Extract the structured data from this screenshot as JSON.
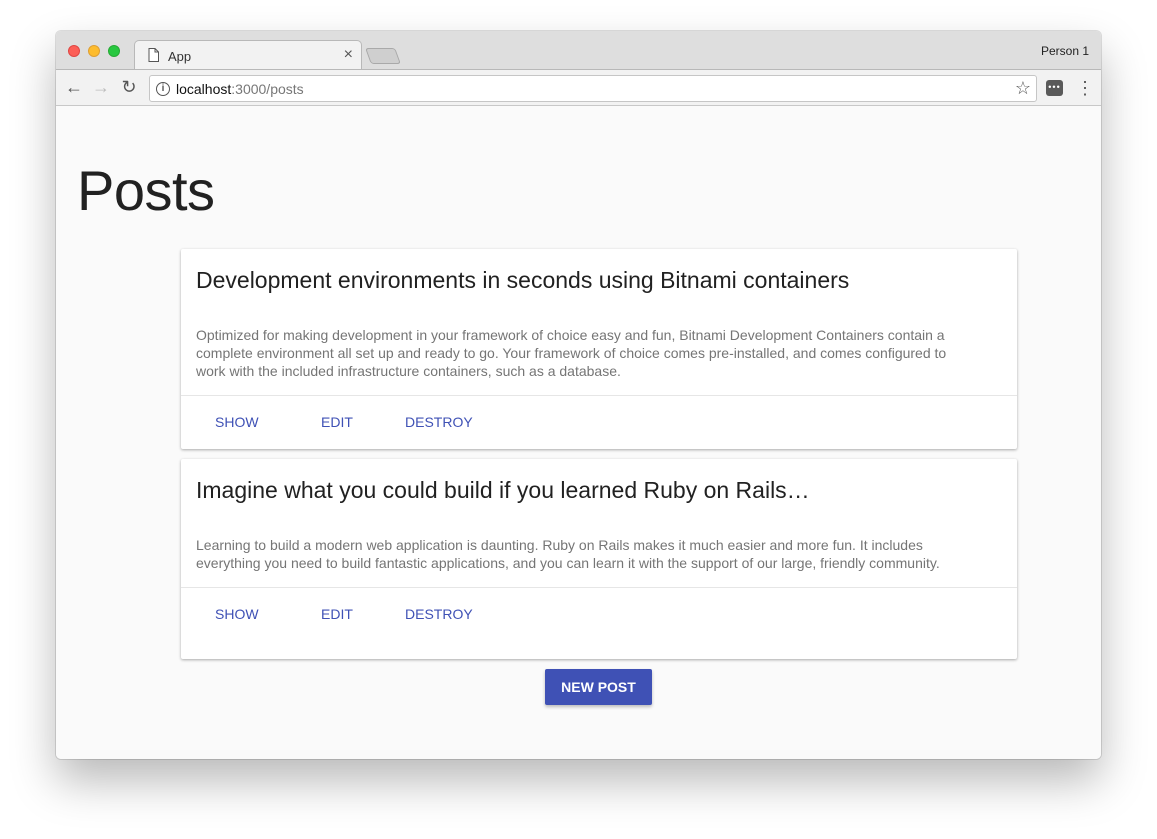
{
  "browser": {
    "tab_title": "App",
    "tab_close": "×",
    "profile": "Person 1",
    "url_host": "localhost",
    "url_rest": ":3000/posts",
    "info_glyph": "i",
    "back_glyph": "←",
    "forward_glyph": "→",
    "reload_glyph": "↻",
    "star_glyph": "☆",
    "ext_glyph": "•••",
    "menu_glyph": "⋮"
  },
  "page": {
    "title": "Posts",
    "new_post_label": "NEW POST"
  },
  "posts": [
    {
      "title": "Development environments in seconds using Bitnami containers",
      "body": "Optimized for making development in your framework of choice easy and fun, Bitnami Development Containers contain a complete environment all set up and ready to go. Your framework of choice comes pre-installed, and comes configured to work with the included infrastructure containers, such as a database.",
      "actions": {
        "show": "SHOW",
        "edit": "EDIT",
        "destroy": "DESTROY"
      }
    },
    {
      "title": "Imagine what you could build if you learned Ruby on Rails…",
      "body": "Learning to build a modern web application is daunting. Ruby on Rails makes it much easier and more fun. It includes everything you need to build fantastic applications, and you can learn it with the support of our large, friendly community.",
      "actions": {
        "show": "SHOW",
        "edit": "EDIT",
        "destroy": "DESTROY"
      }
    }
  ],
  "colors": {
    "accent": "#3f51b5",
    "page_bg": "#fafafa",
    "card_bg": "#ffffff"
  }
}
